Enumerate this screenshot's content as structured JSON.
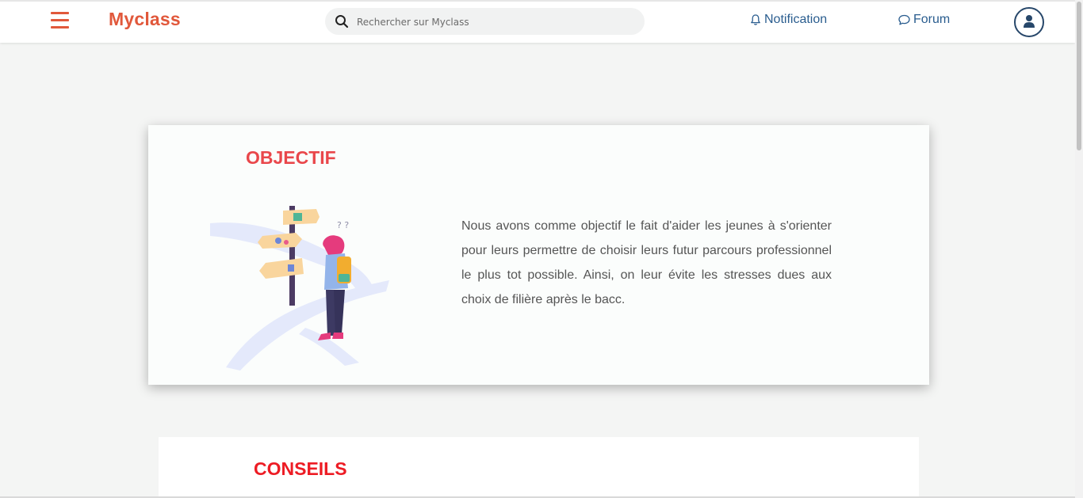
{
  "header": {
    "brand": "Myclass",
    "search_placeholder": "Rechercher sur Myclass",
    "notification_label": "Notification",
    "forum_label": "Forum",
    "icons": [
      "menu-icon",
      "search-icon",
      "bell-icon",
      "chat-bubble-icon",
      "user-avatar-icon"
    ]
  },
  "objectif": {
    "title": "OBJECTIF",
    "text": "Nous avons comme objectif le fait d'aider les jeunes à s'orienter pour leurs permettre de choisir leurs futur parcours professionnel le plus tot possible. Ainsi, on leur évite les stresses dues aux choix de filière après le bacc."
  },
  "conseils": {
    "title": "CONSEILS"
  },
  "colors": {
    "brand": "#e1583b",
    "objectif_title": "#e9474b",
    "conseils_title": "#ed1c24",
    "nav_link": "#2a5d8f",
    "avatar": "#27476a",
    "page_background": "#f4f5f4"
  }
}
